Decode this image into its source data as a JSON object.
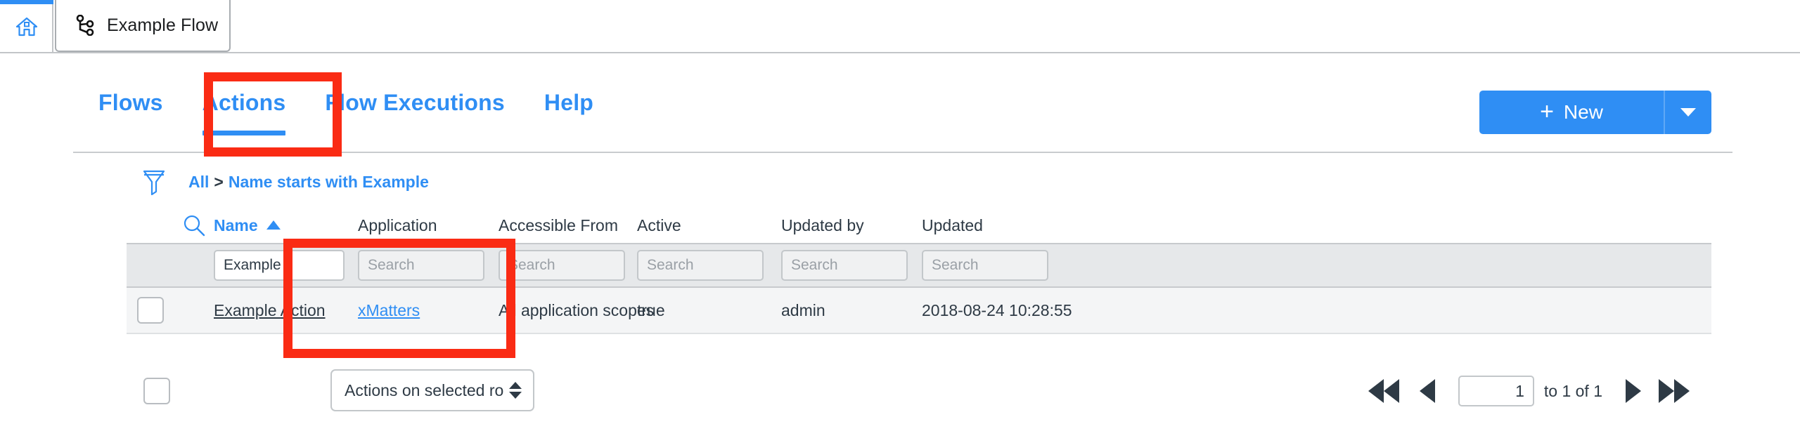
{
  "window": {
    "home_tab_icon": "home-icon",
    "flow_tab": {
      "icon": "flow-branch-icon",
      "label": "Example Flow"
    }
  },
  "nav": {
    "tabs": [
      {
        "label": "Flows",
        "active": false
      },
      {
        "label": "Actions",
        "active": true
      },
      {
        "label": "Flow Executions",
        "active": false
      },
      {
        "label": "Help",
        "active": false
      }
    ]
  },
  "toolbar": {
    "new_button": {
      "plus": "+",
      "label": "New",
      "caret_icon": "chevron-down-icon"
    }
  },
  "breadcrumb": {
    "filter_icon": "funnel-icon",
    "items": [
      "All",
      "Name starts with Example"
    ],
    "separator": ">"
  },
  "table": {
    "search_icon": "search-icon",
    "columns": [
      {
        "key": "name",
        "label": "Name",
        "sorted": true,
        "sort_dir": "asc"
      },
      {
        "key": "app",
        "label": "Application",
        "sorted": false
      },
      {
        "key": "accessible",
        "label": "Accessible From",
        "sorted": false
      },
      {
        "key": "active",
        "label": "Active",
        "sorted": false
      },
      {
        "key": "updated_by",
        "label": "Updated by",
        "sorted": false
      },
      {
        "key": "updated",
        "label": "Updated",
        "sorted": false
      }
    ],
    "filters": {
      "name": {
        "value": "Example",
        "placeholder": "Search"
      },
      "app": {
        "value": "",
        "placeholder": "Search"
      },
      "accessible": {
        "value": "",
        "placeholder": "Search"
      },
      "active": {
        "value": "",
        "placeholder": "Search"
      },
      "updated_by": {
        "value": "",
        "placeholder": "Search"
      },
      "updated": {
        "value": "",
        "placeholder": "Search"
      }
    },
    "rows": [
      {
        "name": "Example Action",
        "app": "xMatters",
        "accessible": "All application scopes",
        "active": "true",
        "updated_by": "admin",
        "updated": "2018-08-24 10:28:55"
      }
    ]
  },
  "footer": {
    "bulk_actions_label": "Actions on selected rows...",
    "pagination": {
      "first_icon": "double-left-arrow-icon",
      "prev_icon": "left-arrow-icon",
      "page_value": "1",
      "range_text": "to 1 of 1",
      "next_icon": "right-arrow-icon",
      "last_icon": "double-right-arrow-icon"
    }
  },
  "annotations": {
    "boxes": [
      {
        "name": "actions-tab-highlight",
        "color": "#fa2b14"
      },
      {
        "name": "name-column-highlight",
        "color": "#fa2b14"
      }
    ]
  }
}
